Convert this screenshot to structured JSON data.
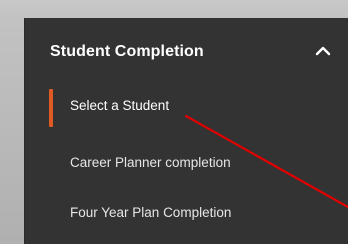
{
  "panel": {
    "title": "Student Completion",
    "collapse_icon": "chevron-up-icon",
    "active_color": "#e05a24",
    "items": [
      {
        "label": "Select a Student",
        "active": true
      },
      {
        "label": "Career Planner completion",
        "active": false
      },
      {
        "label": "Four Year Plan Completion",
        "active": false
      }
    ]
  },
  "annotation": {
    "type": "arrow",
    "color": "#e00000"
  }
}
